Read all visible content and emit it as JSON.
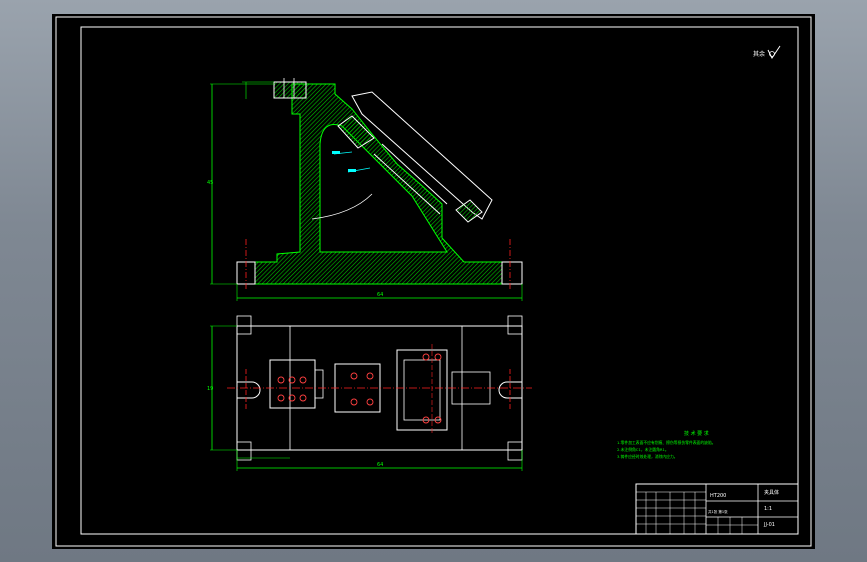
{
  "sheet": {
    "background_color": "#000000",
    "frame_color": "#ffffff",
    "outline_color": "#00ff00",
    "hatch_color": "#00c000",
    "center_color": "#ff2020",
    "dim_color": "#00ff00",
    "leader_color": "#00ffff"
  },
  "roughness_mark": {
    "label": "其余"
  },
  "dimensions": {
    "front_base_width": "64",
    "front_height": "45",
    "top_total_width": "64",
    "top_total_height": "19"
  },
  "notes": {
    "title": "技 术 要 求",
    "lines": [
      "1.零件加工表面不应有划痕、擦伤等损伤零件表面的缺陷。",
      "2.未注倒角C1，未注圆角R1。",
      "3.铸件应经时效处理，消除内应力。"
    ]
  },
  "title_block": {
    "part_name": "夹具体",
    "material": "HT200",
    "scale": "1:1",
    "drawing_no": "JJ-01",
    "sheet": "共1张 第1张"
  }
}
